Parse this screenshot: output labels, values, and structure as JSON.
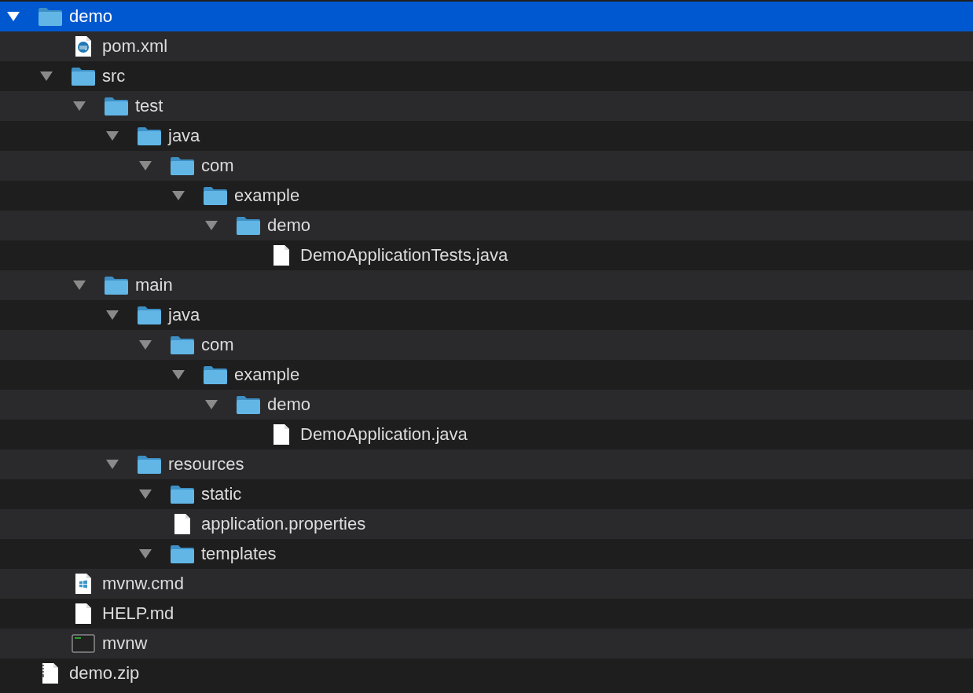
{
  "tree": [
    {
      "name": "demo",
      "kind": "folder",
      "expanded": true,
      "selected": true,
      "children": [
        {
          "name": "pom.xml",
          "kind": "maven",
          "selected": false
        },
        {
          "name": "src",
          "kind": "folder",
          "expanded": true,
          "selected": false,
          "children": [
            {
              "name": "test",
              "kind": "folder",
              "expanded": true,
              "selected": false,
              "children": [
                {
                  "name": "java",
                  "kind": "folder",
                  "expanded": true,
                  "selected": false,
                  "children": [
                    {
                      "name": "com",
                      "kind": "folder",
                      "expanded": true,
                      "selected": false,
                      "children": [
                        {
                          "name": "example",
                          "kind": "folder",
                          "expanded": true,
                          "selected": false,
                          "children": [
                            {
                              "name": "demo",
                              "kind": "folder",
                              "expanded": true,
                              "selected": false,
                              "children": [
                                {
                                  "name": "DemoApplicationTests.java",
                                  "kind": "file",
                                  "selected": false
                                }
                              ]
                            }
                          ]
                        }
                      ]
                    }
                  ]
                }
              ]
            },
            {
              "name": "main",
              "kind": "folder",
              "expanded": true,
              "selected": false,
              "children": [
                {
                  "name": "java",
                  "kind": "folder",
                  "expanded": true,
                  "selected": false,
                  "children": [
                    {
                      "name": "com",
                      "kind": "folder",
                      "expanded": true,
                      "selected": false,
                      "children": [
                        {
                          "name": "example",
                          "kind": "folder",
                          "expanded": true,
                          "selected": false,
                          "children": [
                            {
                              "name": "demo",
                              "kind": "folder",
                              "expanded": true,
                              "selected": false,
                              "children": [
                                {
                                  "name": "DemoApplication.java",
                                  "kind": "file",
                                  "selected": false
                                }
                              ]
                            }
                          ]
                        }
                      ]
                    }
                  ]
                },
                {
                  "name": "resources",
                  "kind": "folder",
                  "expanded": true,
                  "selected": false,
                  "children": [
                    {
                      "name": "static",
                      "kind": "folder",
                      "expanded": true,
                      "selected": false
                    },
                    {
                      "name": "application.properties",
                      "kind": "file",
                      "selected": false
                    },
                    {
                      "name": "templates",
                      "kind": "folder",
                      "expanded": true,
                      "selected": false
                    }
                  ]
                }
              ]
            }
          ]
        },
        {
          "name": "mvnw.cmd",
          "kind": "windows",
          "selected": false
        },
        {
          "name": "HELP.md",
          "kind": "file",
          "selected": false
        },
        {
          "name": "mvnw",
          "kind": "terminal",
          "selected": false
        }
      ]
    },
    {
      "name": "demo.zip",
      "kind": "zip",
      "selected": false
    }
  ]
}
